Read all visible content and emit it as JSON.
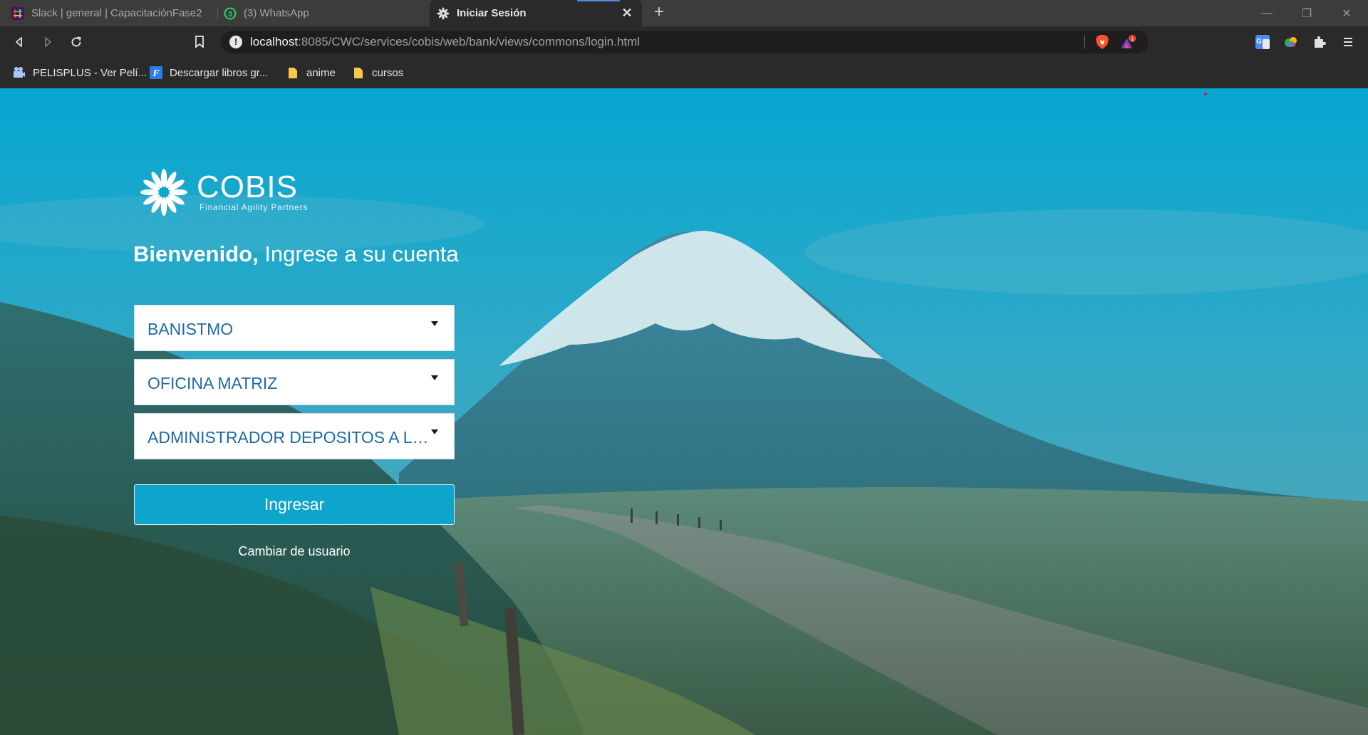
{
  "browser": {
    "tabs": [
      {
        "title": "Slack | general | CapacitaciónFase2",
        "icon": "slack-icon",
        "active": false
      },
      {
        "title": "(3) WhatsApp",
        "icon": "whatsapp-icon",
        "badge": "3",
        "active": false
      },
      {
        "title": "Iniciar Sesión",
        "icon": "cobis-icon",
        "active": true,
        "close": "✕"
      }
    ],
    "new_tab": "+",
    "window_controls": {
      "minimize": "—",
      "restore": "❐",
      "close": "✕"
    },
    "url": {
      "host": "localhost",
      "rest": ":8085/CWC/services/cobis/web/bank/views/commons/login.html"
    },
    "brave_badge": "1",
    "bookmarks": [
      {
        "label": "PELISPLUS - Ver Pelí...",
        "icon": "pelisplus-icon"
      },
      {
        "label": "Descargar libros gr...",
        "icon": "f-icon"
      },
      {
        "label": "anime",
        "icon": "folder-icon"
      },
      {
        "label": "cursos",
        "icon": "folder-icon"
      }
    ]
  },
  "login": {
    "logo_text": "COBIS",
    "logo_tagline": "Financial Agility Partners",
    "welcome_bold": "Bienvenido,",
    "welcome_rest": " Ingrese a su cuenta",
    "selects": [
      {
        "name": "bank-select",
        "value": "BANISTMO"
      },
      {
        "name": "office-select",
        "value": "OFICINA MATRIZ"
      },
      {
        "name": "role-select",
        "value": "ADMINISTRADOR DEPOSITOS A LA VISTA"
      }
    ],
    "submit_label": "Ingresar",
    "change_user_label": "Cambiar de usuario"
  },
  "colors": {
    "accent": "#0ea5cd",
    "select_text": "#1d6aa3",
    "sky": "#0aa7cf"
  }
}
